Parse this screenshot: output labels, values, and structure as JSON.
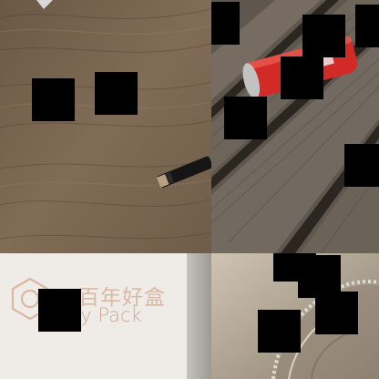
{
  "logo": {
    "chinese": "百年好盒",
    "english": "ucky Pack"
  }
}
